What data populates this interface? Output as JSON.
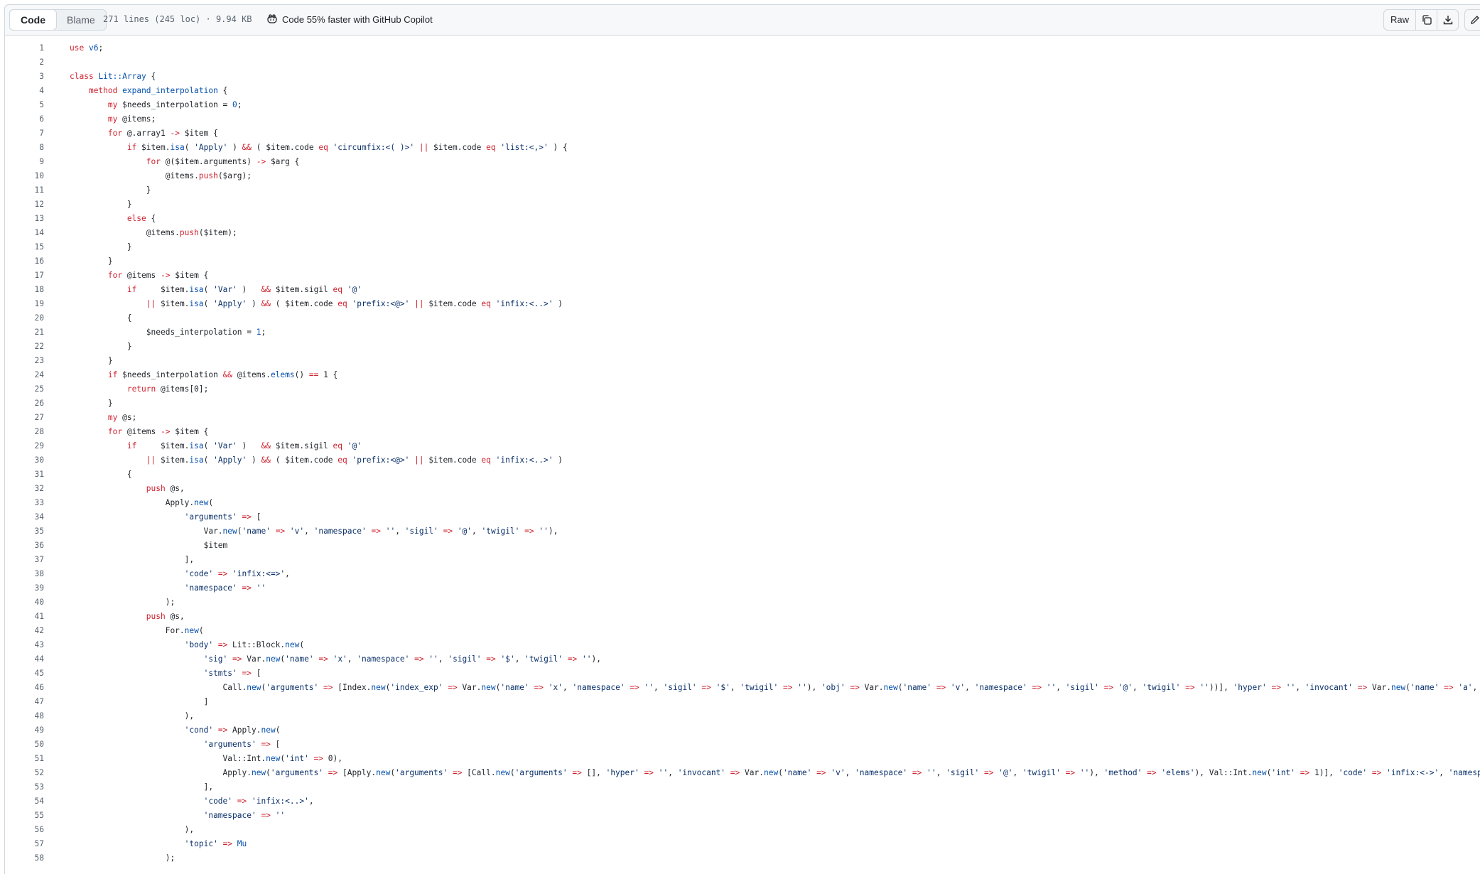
{
  "toolbar": {
    "tab_code": "Code",
    "tab_blame": "Blame",
    "file_info": "271 lines (245 loc) · 9.94 KB",
    "copilot_text": "Code 55% faster with GitHub Copilot",
    "raw_label": "Raw"
  },
  "icons": {
    "copilot": "copilot-icon",
    "copy": "copy-icon",
    "download": "download-icon",
    "edit": "pencil-icon",
    "dropdown": "chevron-down-icon"
  },
  "colors": {
    "keyword": "#cf222e",
    "function": "#0550ae",
    "string": "#0a3069",
    "line_number": "#59636e"
  },
  "code": {
    "line_numbers": [
      "1",
      "2",
      "3",
      "4",
      "5",
      "6",
      "7",
      "8",
      "9",
      "10",
      "11",
      "12",
      "13",
      "14",
      "15",
      "16",
      "17",
      "18",
      "19",
      "20",
      "21",
      "22",
      "23",
      "24",
      "25",
      "26",
      "27",
      "28",
      "29",
      "30",
      "31",
      "32",
      "33",
      "34",
      "35",
      "36",
      "37",
      "38",
      "39",
      "40",
      "41",
      "42",
      "43",
      "44",
      "45",
      "46",
      "47",
      "48",
      "49",
      "50",
      "51",
      "52",
      "53",
      "54",
      "55",
      "56",
      "57",
      "58"
    ],
    "lines": [
      "use v6;",
      "",
      "class Lit::Array {",
      "    method expand_interpolation {",
      "        my $needs_interpolation = 0;",
      "        my @items;",
      "        for @.array1 -> $item {",
      "            if $item.isa( 'Apply' ) && ( $item.code eq 'circumfix:<( )>' || $item.code eq 'list:<,>' ) {",
      "                for @($item.arguments) -> $arg {",
      "                    @items.push($arg);",
      "                }",
      "            }",
      "            else {",
      "                @items.push($item);",
      "            }",
      "        }",
      "        for @items -> $item {",
      "            if     $item.isa( 'Var' )   && $item.sigil eq '@'",
      "                || $item.isa( 'Apply' ) && ( $item.code eq 'prefix:<@>' || $item.code eq 'infix:<..>' )",
      "            {",
      "                $needs_interpolation = 1;",
      "            }",
      "        }",
      "        if $needs_interpolation && @items.elems() == 1 {",
      "            return @items[0];",
      "        }",
      "        my @s;",
      "        for @items -> $item {",
      "            if     $item.isa( 'Var' )   && $item.sigil eq '@'",
      "                || $item.isa( 'Apply' ) && ( $item.code eq 'prefix:<@>' || $item.code eq 'infix:<..>' )",
      "            {",
      "                push @s,",
      "                    Apply.new(",
      "                        'arguments' => [",
      "                            Var.new('name' => 'v', 'namespace' => '', 'sigil' => '@', 'twigil' => ''),",
      "                            $item",
      "                        ],",
      "                        'code' => 'infix:<=>',",
      "                        'namespace' => ''",
      "                    );",
      "                push @s,",
      "                    For.new(",
      "                        'body' => Lit::Block.new(",
      "                            'sig' => Var.new('name' => 'x', 'namespace' => '', 'sigil' => '$', 'twigil' => ''),",
      "                            'stmts' => [",
      "                                Call.new('arguments' => [Index.new('index_exp' => Var.new('name' => 'x', 'namespace' => '', 'sigil' => '$', 'twigil' => ''), 'obj' => Var.new('name' => 'v', 'namespace' => '', 'sigil' => '@', 'twigil' => ''))], 'hyper' => '', 'invocant' => Var.new('name' => 'a', 'names",
      "                            ]",
      "                        ),",
      "                        'cond' => Apply.new(",
      "                            'arguments' => [",
      "                                Val::Int.new('int' => 0),",
      "                                Apply.new('arguments' => [Apply.new('arguments' => [Call.new('arguments' => [], 'hyper' => '', 'invocant' => Var.new('name' => 'v', 'namespace' => '', 'sigil' => '@', 'twigil' => ''), 'method' => 'elems'), Val::Int.new('int' => 1)], 'code' => 'infix:<->', 'namespace' =",
      "                            ],",
      "                            'code' => 'infix:<..>',",
      "                            'namespace' => ''",
      "                        ),",
      "                        'topic' => Mu",
      "                    );"
    ]
  }
}
